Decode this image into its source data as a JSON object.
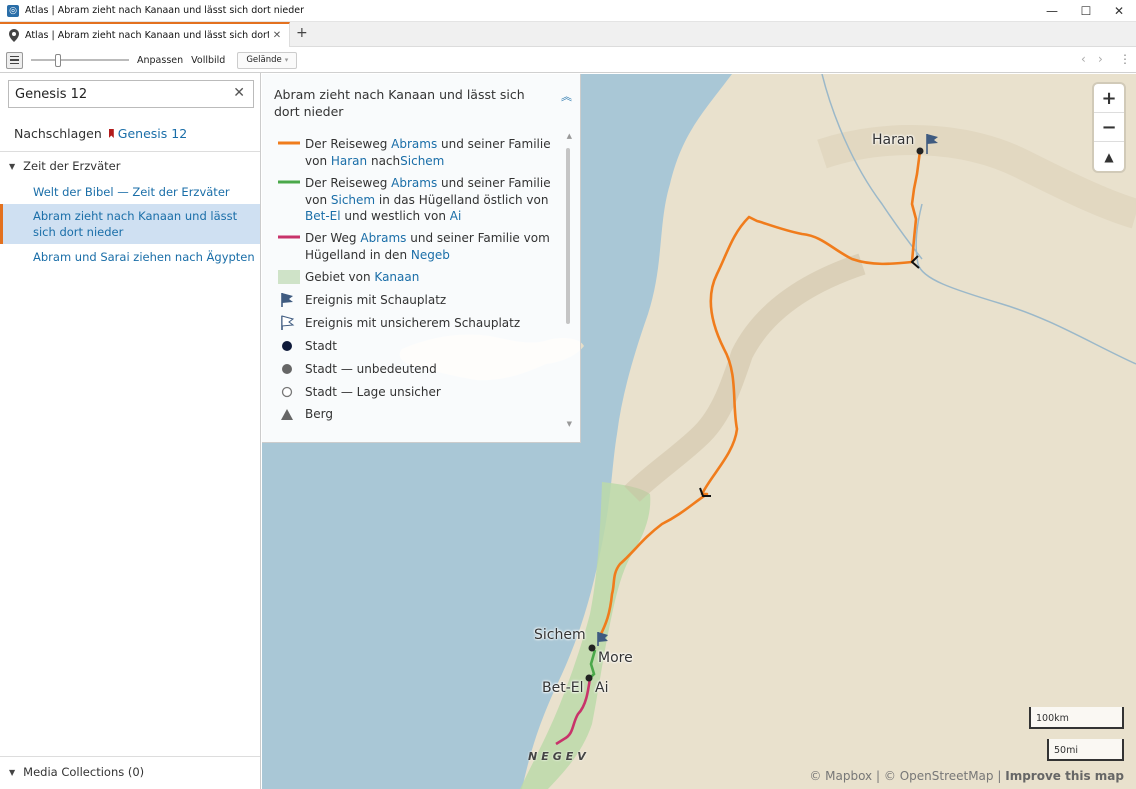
{
  "window": {
    "title": "Atlas | Abram zieht nach Kanaan und lässt sich dort nieder",
    "minimize": "—",
    "maximize": "☐",
    "close": "✕"
  },
  "tab": {
    "label": "Atlas | Abram zieht nach Kanaan und lässt sich dort nieder",
    "close": "✕",
    "new_tab": "+"
  },
  "toolbar": {
    "fit_label": "Anpassen",
    "fullscreen_label": "Vollbild",
    "terrain_label": "Gelände",
    "back_arrow": "‹",
    "forward_arrow": "›",
    "more": "⋮"
  },
  "sidebar": {
    "search_value": "Genesis 12",
    "search_clear": "✕",
    "lookup_label": "Nachschlagen",
    "lookup_ref": "Genesis 12",
    "section_title": "Zeit der Erzväter",
    "items": [
      {
        "label": "Welt der Bibel — Zeit der Erzväter",
        "selected": false
      },
      {
        "label": "Abram zieht nach Kanaan und lässt sich dort nieder",
        "selected": true
      },
      {
        "label": "Abram und Sarai ziehen nach Ägypten",
        "selected": false
      }
    ],
    "media_collections": "Media Collections (0)"
  },
  "legend": {
    "title": "Abram zieht nach Kanaan und lässt sich dort nieder",
    "collapse_icon": "︽",
    "route1": {
      "p1": "Der Reiseweg ",
      "l1": "Abrams",
      "p2": " und seiner Familie von ",
      "l2": "Haran",
      "p3": " nach",
      "l3": "Sichem"
    },
    "route2": {
      "p1": "Der Reiseweg ",
      "l1": "Abrams",
      "p2": " und seiner Familie von ",
      "l2": "Sichem",
      "p3": " in das Hügelland östlich von ",
      "l3": "Bet-El",
      "p4": " und westlich von ",
      "l4": "Ai"
    },
    "route3": {
      "p1": "Der Weg ",
      "l1": "Abrams",
      "p2": " und seiner Familie vom Hügelland in den ",
      "l2": "Negeb"
    },
    "region": {
      "p1": "Gebiet von ",
      "l1": "Kanaan"
    },
    "event": "Ereignis mit Schauplatz",
    "event_uncertain": "Ereignis mit unsicherem Schauplatz",
    "city": "Stadt",
    "city_minor": "Stadt — unbedeutend",
    "city_uncertain": "Stadt — Lage unsicher",
    "mountain": "Berg",
    "colors": {
      "route1": "#f07c1c",
      "route2": "#4aa84a",
      "route3": "#c8336a",
      "region": "#cfe3c8",
      "flag": "#3f5b80"
    }
  },
  "map": {
    "labels": {
      "haran": "Haran",
      "sichem": "Sichem",
      "more": "More",
      "betel": "Bet-El",
      "ai": "Ai",
      "negev": "NEGEV"
    },
    "zoom_in": "+",
    "zoom_out": "−",
    "compass": "▲",
    "scale_km": "100km",
    "scale_mi": "50mi",
    "attribution": {
      "mapbox": "© Mapbox",
      "sep": "|",
      "osm": "© OpenStreetMap",
      "improve": "Improve this map"
    },
    "colors": {
      "sea": "#a9c7d6",
      "land": "#e9e1cd",
      "canaan": "#bcd9a9"
    }
  }
}
